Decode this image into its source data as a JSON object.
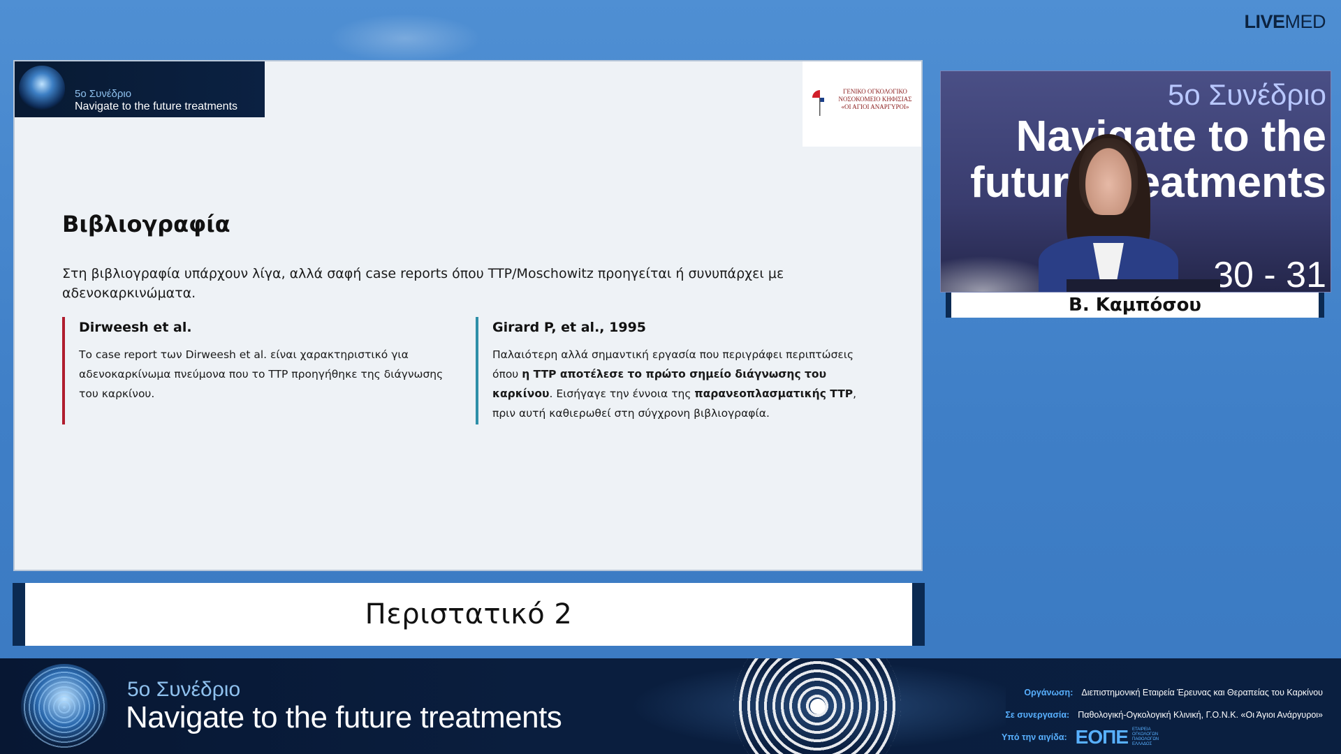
{
  "brand": {
    "part1": "LIVE",
    "part2": "MED"
  },
  "slide": {
    "banner": {
      "line1": "5ο Συνέδριο",
      "line2": "Navigate to the future treatments"
    },
    "logo_text": "ΓΕΝΙΚΟ ΟΓΚΟΛΟΓΙΚΟ ΝΟΣΟΚΟΜΕΙΟ ΚΗΦΙΣΙΑΣ «ΟΙ ΑΓΙΟΙ ΑΝΑΡΓΥΡΟΙ»",
    "title": "Βιβλιογραφία",
    "intro": "Στη βιβλιογραφία υπάρχουν λίγα, αλλά σαφή case reports όπου TTP/Moschowitz προηγείται ή συνυπάρχει με αδενοκαρκινώματα.",
    "left": {
      "title": "Dirweesh et al.",
      "body": "Το case report των Dirweesh et al. είναι χαρακτηριστικό για αδενοκαρκίνωμα πνεύμονα που το TTP προηγήθηκε της διάγνωσης του καρκίνου."
    },
    "right": {
      "title": "Girard P, et al., 1995",
      "body_1": "Παλαιότερη αλλά σημαντική εργασία που περιγράφει περιπτώσεις όπου ",
      "body_bold_1": "η TTP αποτέλεσε το πρώτο σημείο διάγνωσης του καρκίνου",
      "body_2": ". Εισήγαγε την έννοια της ",
      "body_bold_2": "παρανεοπλασματικής TTP",
      "body_3": ", πριν αυτή καθιερωθεί στη σύγχρονη βιβλιογραφία."
    }
  },
  "caption": "Περιστατικό 2",
  "video": {
    "line1": "5ο Συνέδριο",
    "line2": "Navigate to the",
    "line3": "future treatments",
    "line4": "30 - 31"
  },
  "speaker_name": "Β. Καμπόσου",
  "footer": {
    "line1": "5ο Συνέδριο",
    "line2": "Navigate to the future treatments",
    "org_key": "Οργάνωση:",
    "org_val": "Διεπιστημονική Εταιρεία Έρευνας και Θεραπείας του Καρκίνου",
    "coop_key": "Σε συνεργασία:",
    "coop_val": "Παθολογική-Ογκολογική Κλινική, Γ.Ο.Ν.Κ. «Οι Άγιοι Ανάργυροι»",
    "aegis_key": "Υπό την αιγίδα:",
    "aegis_logo": "ΕΟΠΕ",
    "aegis_sub": "ΕΤΑΙΡΕΙΑ ΟΓΚΟΛΟΓΩΝ ΠΑΘΟΛΟΓΩΝ ΕΛΛΑΔΟΣ"
  },
  "colors": {
    "accent_red": "#b01d2e",
    "accent_teal": "#2e8fa8",
    "navy": "#0b2a52",
    "footer_key": "#58b0ff"
  }
}
